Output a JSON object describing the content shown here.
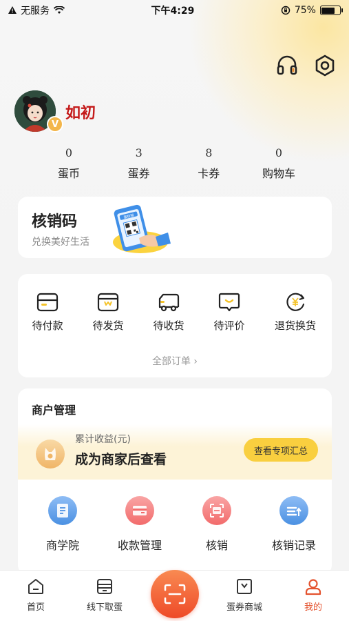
{
  "status_bar": {
    "carrier": "无服务",
    "time": "下午4:29",
    "battery": "75%",
    "battery_level": 0.75
  },
  "header": {
    "icons": [
      "headset-icon",
      "settings-icon"
    ]
  },
  "profile": {
    "username": "如初",
    "badge": "V"
  },
  "stats": [
    {
      "value": "0",
      "label": "蛋币"
    },
    {
      "value": "3",
      "label": "蛋券"
    },
    {
      "value": "8",
      "label": "卡券"
    },
    {
      "value": "0",
      "label": "购物车"
    }
  ],
  "verify_card": {
    "title": "核销码",
    "subtitle": "兑换美好生活",
    "phone_text": "蛋核销"
  },
  "orders": {
    "items": [
      {
        "label": "待付款",
        "icon": "wallet-icon"
      },
      {
        "label": "待发货",
        "icon": "package-icon"
      },
      {
        "label": "待收货",
        "icon": "truck-icon"
      },
      {
        "label": "待评价",
        "icon": "comment-icon"
      },
      {
        "label": "退货换货",
        "icon": "refund-icon"
      }
    ],
    "all_orders": "全部订单 ›"
  },
  "merchant": {
    "title": "商户管理",
    "earnings_label": "累计收益(元)",
    "earnings_value": "成为商家后查看",
    "summary_button": "查看专项汇总",
    "tools": [
      {
        "label": "商学院",
        "icon": "document-icon",
        "color": "#4a90e2"
      },
      {
        "label": "收款管理",
        "icon": "card-icon",
        "color": "#f26b6b"
      },
      {
        "label": "核销",
        "icon": "scan-icon",
        "color": "#f26b6b"
      },
      {
        "label": "核销记录",
        "icon": "record-icon",
        "color": "#4a90e2"
      }
    ]
  },
  "tabbar": {
    "tabs": [
      {
        "label": "首页",
        "icon": "home-icon"
      },
      {
        "label": "线下取蛋",
        "icon": "store-icon"
      },
      {
        "label": "蛋券商城",
        "icon": "mall-icon"
      },
      {
        "label": "我的",
        "icon": "profile-icon",
        "active": true
      }
    ],
    "center_icon": "scan-icon",
    "accent_color": "#e4532f"
  }
}
